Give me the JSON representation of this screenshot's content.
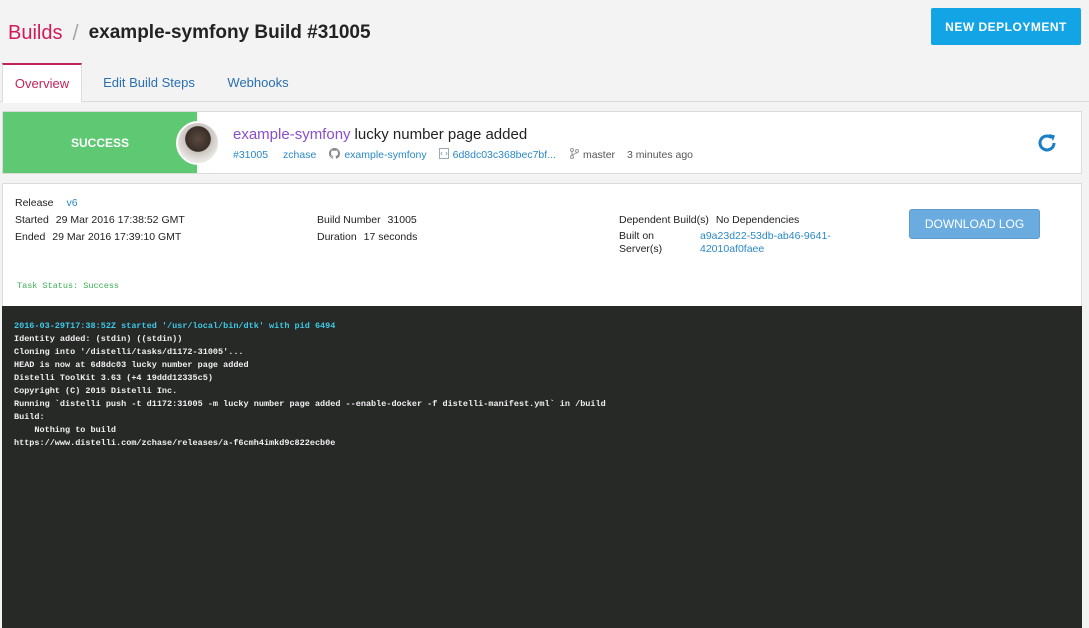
{
  "header": {
    "crumb_builds": "Builds",
    "crumb_sep": "/",
    "title": "example-symfony Build #31005",
    "new_deployment": "NEW DEPLOYMENT"
  },
  "tabs": [
    {
      "label": "Overview",
      "active": true
    },
    {
      "label": "Edit Build Steps",
      "active": false
    },
    {
      "label": "Webhooks",
      "active": false
    }
  ],
  "status": {
    "state": "SUCCESS",
    "repo": "example-symfony",
    "message": "lucky number page added",
    "build_num": "#31005",
    "user": "zchase",
    "github_repo": "example-symfony",
    "commit": "6d8dc03c368bec7bf...",
    "branch": "master",
    "time": "3 minutes ago"
  },
  "info": {
    "release_label": "Release",
    "release_value": "v6",
    "started_label": "Started",
    "started_value": "29 Mar 2016 17:38:52 GMT",
    "ended_label": "Ended",
    "ended_value": "29 Mar 2016 17:39:10 GMT",
    "build_number_label": "Build Number",
    "build_number_value": "31005",
    "duration_label": "Duration",
    "duration_value": "17 seconds",
    "dependent_label": "Dependent Build(s)",
    "dependent_value": "No Dependencies",
    "built_on_label_1": "Built on",
    "built_on_label_2": "Server(s)",
    "server_1": "a9a23d22-53db-ab46-9641-",
    "server_2": "42010af0faee",
    "download_log": "DOWNLOAD LOG"
  },
  "task_status": "Task Status: Success",
  "terminal": [
    "2016-03-29T17:38:52Z started '/usr/local/bin/dtk' with pid 6494",
    "Identity added: (stdin) ((stdin))",
    "Cloning into '/distelli/tasks/d1172-31005'...",
    "HEAD is now at 6d8dc03 lucky number page added",
    "Distelli ToolKit 3.63 (+4 19ddd12335c5)",
    "Copyright (C) 2015 Distelli Inc.",
    "Running `distelli push -t d1172:31005 -m lucky number page added --enable-docker -f distelli-manifest.yml` in /build",
    "Build:",
    "    Nothing to build",
    "https://www.distelli.com/zchase/releases/a-f6cmh4imkd9c822ecb0e"
  ],
  "colors": {
    "accent_pink": "#c0245a",
    "primary_blue": "#13a4e6",
    "success_green": "#5ec872",
    "terminal_bg": "#272927"
  }
}
